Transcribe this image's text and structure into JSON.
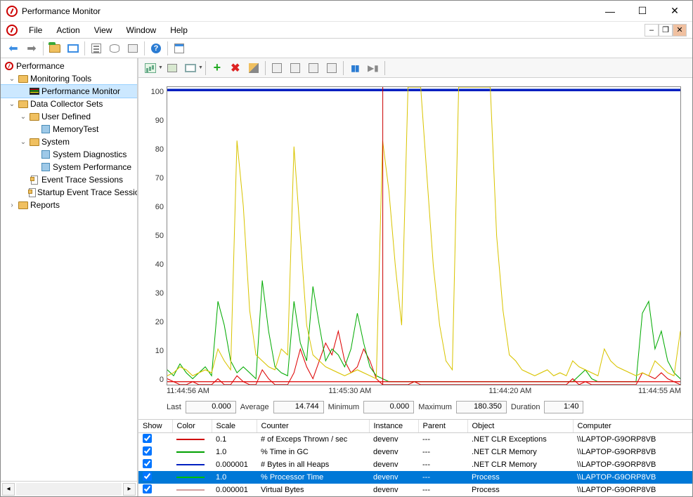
{
  "window": {
    "title": "Performance Monitor"
  },
  "menu": {
    "file": "File",
    "action": "Action",
    "view": "View",
    "window": "Window",
    "help": "Help"
  },
  "tree": {
    "root": "Performance",
    "monitoring_tools": "Monitoring Tools",
    "performance_monitor": "Performance Monitor",
    "data_collector_sets": "Data Collector Sets",
    "user_defined": "User Defined",
    "memory_test": "MemoryTest",
    "system": "System",
    "system_diagnostics": "System Diagnostics",
    "system_performance": "System Performance",
    "event_trace_sessions": "Event Trace Sessions",
    "startup_event_trace": "Startup Event Trace Sessions",
    "reports": "Reports"
  },
  "chart_data": {
    "type": "line",
    "ylim": [
      0,
      100
    ],
    "yticks": [
      100,
      90,
      80,
      70,
      60,
      50,
      40,
      30,
      20,
      10,
      0
    ],
    "xticks": [
      "11:44:56 AM",
      "11:45:30 AM",
      "11:44:20 AM",
      "11:44:55 AM"
    ],
    "gap_x_pct": 42,
    "series": [
      {
        "name": "# Bytes in all Heaps",
        "color": "#0020c0",
        "style": "bar_top",
        "y": 100
      },
      {
        "name": "# of Exceps Thrown / sec",
        "color": "#d00000",
        "values_pct": [
          2,
          1,
          0,
          0,
          1,
          0,
          0,
          0,
          2,
          0,
          0,
          3,
          1,
          0,
          0,
          5,
          2,
          0,
          0,
          0,
          4,
          12,
          6,
          2,
          8,
          14,
          10,
          18,
          8,
          4,
          6,
          12,
          8,
          2,
          0,
          0,
          0,
          0,
          0,
          1,
          0,
          0,
          0,
          0,
          0,
          0,
          0,
          0,
          0,
          0,
          0,
          0,
          0,
          0,
          0,
          0,
          0,
          0,
          0,
          0,
          0,
          0,
          0,
          0,
          2,
          0,
          1,
          0,
          0,
          0,
          0,
          0,
          0,
          0,
          0,
          4,
          3,
          2,
          4,
          2,
          1,
          0
        ]
      },
      {
        "name": "% Time in GC",
        "color": "#00a000",
        "values_pct": [
          5,
          3,
          7,
          4,
          2,
          4,
          6,
          3,
          28,
          20,
          8,
          4,
          6,
          4,
          2,
          35,
          18,
          6,
          4,
          3,
          28,
          14,
          8,
          33,
          20,
          8,
          12,
          10,
          6,
          12,
          24,
          14,
          6,
          3,
          2,
          1,
          1,
          1,
          1,
          1,
          1,
          1,
          1,
          1,
          1,
          1,
          1,
          1,
          1,
          1,
          1,
          1,
          1,
          1,
          1,
          1,
          1,
          1,
          1,
          1,
          1,
          1,
          1,
          1,
          1,
          3,
          5,
          2,
          1,
          1,
          1,
          1,
          1,
          1,
          1,
          24,
          28,
          12,
          18,
          8,
          4,
          2
        ]
      },
      {
        "name": "% Processor Time",
        "color": "#d9c400",
        "values_pct": [
          3,
          4,
          6,
          5,
          3,
          4,
          5,
          4,
          12,
          8,
          5,
          82,
          60,
          25,
          10,
          8,
          6,
          5,
          12,
          10,
          80,
          50,
          20,
          10,
          8,
          6,
          5,
          4,
          3,
          4,
          5,
          4,
          3,
          2,
          82,
          65,
          40,
          20,
          100,
          100,
          100,
          70,
          40,
          20,
          8,
          5,
          100,
          100,
          100,
          100,
          100,
          100,
          50,
          25,
          10,
          8,
          5,
          4,
          3,
          4,
          5,
          3,
          4,
          3,
          8,
          6,
          5,
          4,
          3,
          12,
          8,
          6,
          5,
          4,
          3,
          4,
          3,
          8,
          6,
          4,
          3,
          18
        ]
      },
      {
        "name": "Virtual Bytes",
        "color": "#d0a0a0",
        "values_pct": [
          1,
          1,
          1,
          1,
          1,
          1,
          1,
          1,
          1,
          1,
          1,
          1,
          1,
          1,
          1,
          1,
          1,
          1,
          1,
          1,
          1,
          1,
          1,
          1,
          1,
          1,
          1,
          1,
          1,
          1,
          1,
          1,
          1,
          1,
          1,
          1,
          1,
          1,
          1,
          1,
          1,
          1,
          1,
          1,
          1,
          1,
          1,
          1,
          1,
          1,
          1,
          1,
          1,
          1,
          1,
          1,
          1,
          1,
          1,
          1,
          1,
          1,
          1,
          1,
          1,
          1,
          1,
          1,
          1,
          1,
          1,
          1,
          1,
          1,
          1,
          1,
          1,
          1,
          1,
          1,
          1,
          1
        ]
      }
    ]
  },
  "stats": {
    "last_label": "Last",
    "last": "0.000",
    "avg_label": "Average",
    "avg": "14.744",
    "min_label": "Minimum",
    "min": "0.000",
    "max_label": "Maximum",
    "max": "180.350",
    "dur_label": "Duration",
    "dur": "1:40"
  },
  "table": {
    "headers": {
      "show": "Show",
      "color": "Color",
      "scale": "Scale",
      "counter": "Counter",
      "instance": "Instance",
      "parent": "Parent",
      "object": "Object",
      "computer": "Computer"
    },
    "rows": [
      {
        "show": true,
        "color": "#d00000",
        "scale": "0.1",
        "counter": "# of Exceps Thrown / sec",
        "instance": "devenv",
        "parent": "---",
        "object": ".NET CLR Exceptions",
        "computer": "\\\\LAPTOP-G9ORP8VB",
        "selected": false
      },
      {
        "show": true,
        "color": "#00a000",
        "scale": "1.0",
        "counter": "% Time in GC",
        "instance": "devenv",
        "parent": "---",
        "object": ".NET CLR Memory",
        "computer": "\\\\LAPTOP-G9ORP8VB",
        "selected": false
      },
      {
        "show": true,
        "color": "#0020c0",
        "scale": "0.000001",
        "counter": "# Bytes in all Heaps",
        "instance": "devenv",
        "parent": "---",
        "object": ".NET CLR Memory",
        "computer": "\\\\LAPTOP-G9ORP8VB",
        "selected": false
      },
      {
        "show": true,
        "color": "#00c000",
        "scale": "1.0",
        "counter": "% Processor Time",
        "instance": "devenv",
        "parent": "---",
        "object": "Process",
        "computer": "\\\\LAPTOP-G9ORP8VB",
        "selected": true
      },
      {
        "show": true,
        "color": "#d0a0a0",
        "scale": "0.000001",
        "counter": "Virtual Bytes",
        "instance": "devenv",
        "parent": "---",
        "object": "Process",
        "computer": "\\\\LAPTOP-G9ORP8VB",
        "selected": false
      }
    ]
  }
}
